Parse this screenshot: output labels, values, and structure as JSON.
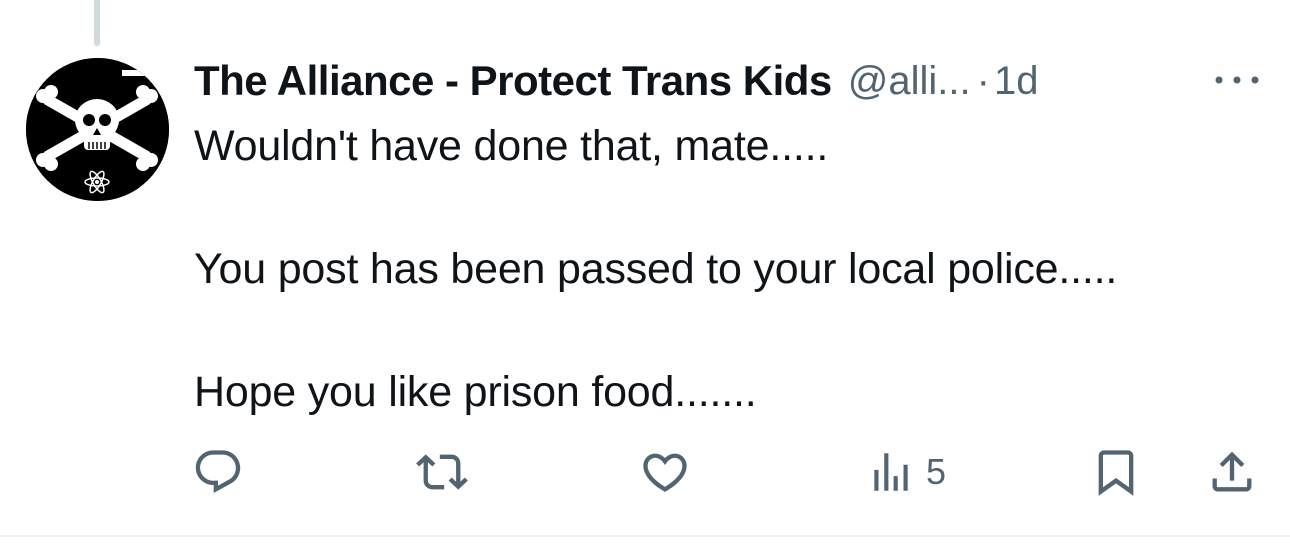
{
  "tweet": {
    "display_name": "The Alliance - Protect Trans Kids",
    "handle": "@alli...",
    "separator": "·",
    "timestamp": "1d",
    "text": "Wouldn't have done that, mate.....\n\nYou post has been passed to your local police.....\n\nHope you like prison food.......",
    "avatar_icon": "skull-crossbones-atom-icon"
  },
  "actions": {
    "reply_icon": "reply-icon",
    "retweet_icon": "retweet-icon",
    "like_icon": "like-heart-icon",
    "views_icon": "views-chart-icon",
    "views_count": "5",
    "bookmark_icon": "bookmark-icon",
    "share_icon": "share-icon"
  },
  "colors": {
    "text_primary": "#0f1419",
    "text_secondary": "#536471",
    "thread_line": "#cfd9de",
    "divider": "#eff3f4"
  }
}
